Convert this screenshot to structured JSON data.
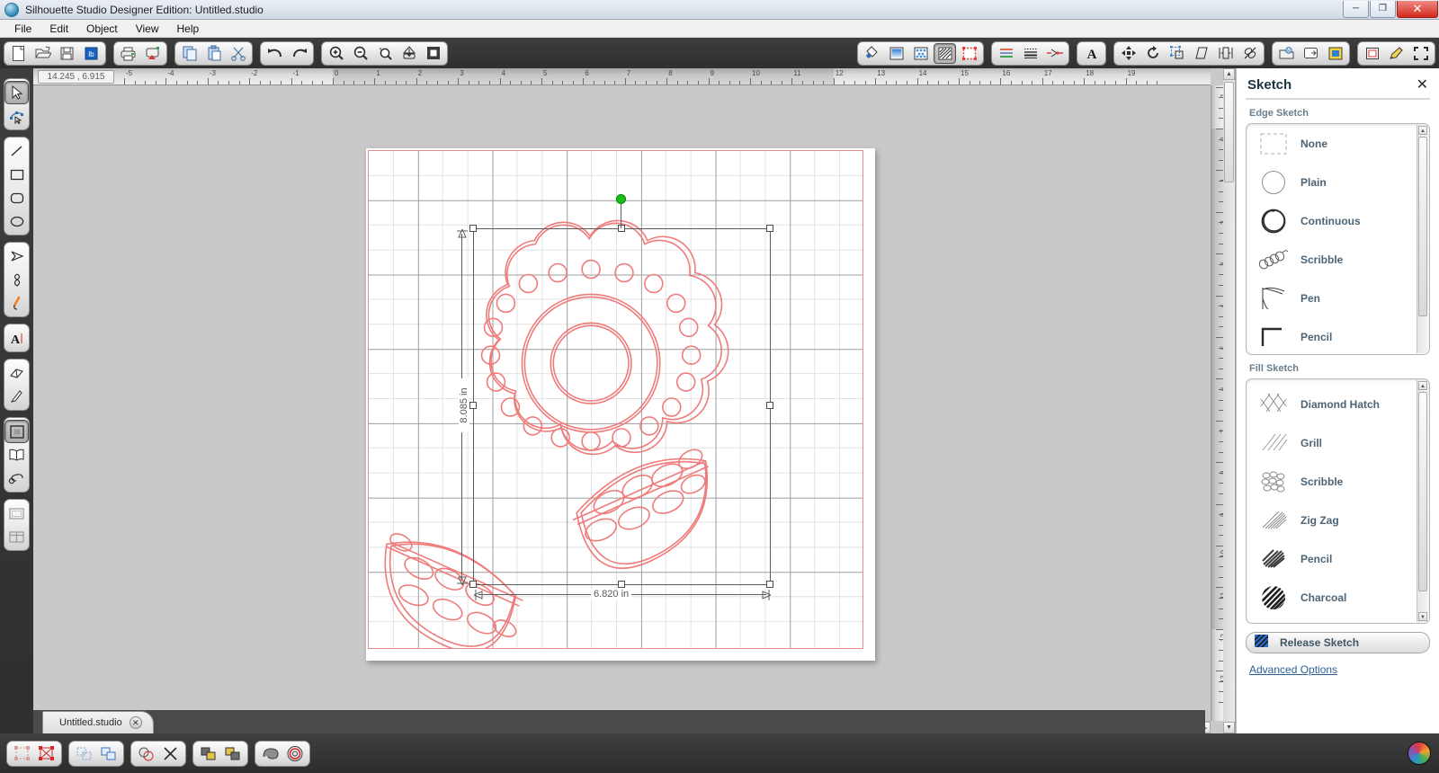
{
  "window": {
    "title": "Silhouette Studio Designer Edition: Untitled.studio",
    "minimize_label": "─",
    "maximize_label": "❐",
    "close_label": "✕"
  },
  "menubar": {
    "items": [
      "File",
      "Edit",
      "Object",
      "View",
      "Help"
    ]
  },
  "toolbar": {
    "groups": [
      {
        "name": "file",
        "buttons": [
          {
            "icon": "new-document-icon",
            "label": "New"
          },
          {
            "icon": "open-folder-icon",
            "label": "Open"
          },
          {
            "icon": "save-icon",
            "label": "Save"
          },
          {
            "icon": "save-library-icon",
            "label": "Save to Library"
          }
        ]
      },
      {
        "name": "output",
        "buttons": [
          {
            "icon": "print-icon",
            "label": "Print"
          },
          {
            "icon": "cut-send-icon",
            "label": "Send to Silhouette"
          }
        ]
      },
      {
        "name": "clipboard",
        "buttons": [
          {
            "icon": "copy-icon",
            "label": "Copy"
          },
          {
            "icon": "paste-icon",
            "label": "Paste"
          },
          {
            "icon": "scissors-icon",
            "label": "Cut"
          }
        ]
      },
      {
        "name": "history",
        "buttons": [
          {
            "icon": "undo-icon",
            "label": "Undo"
          },
          {
            "icon": "redo-icon",
            "label": "Redo"
          }
        ]
      },
      {
        "name": "zoom",
        "buttons": [
          {
            "icon": "zoom-in-icon",
            "label": "Zoom In"
          },
          {
            "icon": "zoom-out-icon",
            "label": "Zoom Out"
          },
          {
            "icon": "zoom-selection-icon",
            "label": "Zoom to Selection"
          },
          {
            "icon": "fit-to-window-icon",
            "label": "Fit to Window"
          },
          {
            "icon": "actual-size-icon",
            "label": "Actual Size"
          }
        ]
      }
    ],
    "right_groups": [
      {
        "name": "design-panels",
        "buttons": [
          {
            "icon": "paint-bucket-icon",
            "label": "Fill Color",
            "selected": false
          },
          {
            "icon": "gradient-fill-icon",
            "label": "Gradient Fill",
            "selected": false
          },
          {
            "icon": "pattern-fill-icon",
            "label": "Pattern Fill",
            "selected": false
          },
          {
            "icon": "sketch-icon",
            "label": "Sketch",
            "selected": true
          },
          {
            "icon": "line-color-icon",
            "label": "Line Color",
            "selected": false
          }
        ]
      },
      {
        "name": "line-style",
        "buttons": [
          {
            "icon": "line-color-swatches-icon",
            "label": "Line Color"
          },
          {
            "icon": "line-style-icon",
            "label": "Line Style"
          },
          {
            "icon": "cut-style-icon",
            "label": "Cut Style"
          }
        ]
      },
      {
        "name": "text",
        "buttons": [
          {
            "icon": "text-style-icon",
            "label": "Text Style"
          }
        ]
      },
      {
        "name": "transform",
        "buttons": [
          {
            "icon": "move-icon",
            "label": "Move"
          },
          {
            "icon": "rotate-icon",
            "label": "Rotate"
          },
          {
            "icon": "scale-icon",
            "label": "Scale"
          },
          {
            "icon": "shear-icon",
            "label": "Shear"
          },
          {
            "icon": "align-icon",
            "label": "Align"
          },
          {
            "icon": "modify-icon",
            "label": "Modify"
          }
        ]
      },
      {
        "name": "page",
        "buttons": [
          {
            "icon": "page-setup-icon",
            "label": "Page Setup"
          },
          {
            "icon": "registration-marks-icon",
            "label": "Registration Marks"
          },
          {
            "icon": "trace-icon",
            "label": "Trace"
          }
        ]
      },
      {
        "name": "view-modes",
        "buttons": [
          {
            "icon": "cut-preview-icon",
            "label": "Cut Preview"
          },
          {
            "icon": "pen-holder-icon",
            "label": "Sketch Preview"
          },
          {
            "icon": "fullscreen-icon",
            "label": "Full Screen"
          }
        ]
      }
    ]
  },
  "left_tools": {
    "groups": [
      {
        "name": "selection",
        "buttons": [
          {
            "icon": "arrow-select-icon",
            "label": "Select",
            "selected": true
          },
          {
            "icon": "edit-points-icon",
            "label": "Edit Points",
            "selected": false
          }
        ]
      },
      {
        "name": "shapes",
        "buttons": [
          {
            "icon": "line-tool-icon",
            "label": "Line"
          },
          {
            "icon": "rectangle-tool-icon",
            "label": "Rectangle"
          },
          {
            "icon": "rounded-rectangle-tool-icon",
            "label": "Rounded Rectangle"
          },
          {
            "icon": "ellipse-tool-icon",
            "label": "Ellipse"
          }
        ]
      },
      {
        "name": "draw",
        "buttons": [
          {
            "icon": "polygon-tool-icon",
            "label": "Polygon"
          },
          {
            "icon": "curve-tool-icon",
            "label": "Curve"
          },
          {
            "icon": "freehand-tool-icon",
            "label": "Freehand"
          }
        ]
      },
      {
        "name": "text-tool",
        "buttons": [
          {
            "icon": "text-tool-icon",
            "label": "Text"
          }
        ]
      },
      {
        "name": "edit-tools",
        "buttons": [
          {
            "icon": "eraser-tool-icon",
            "label": "Eraser"
          },
          {
            "icon": "knife-tool-icon",
            "label": "Knife"
          }
        ]
      },
      {
        "name": "library",
        "buttons": [
          {
            "icon": "my-library-icon",
            "label": "My Library",
            "selected": true
          },
          {
            "icon": "store-icon",
            "label": "Silhouette Store"
          },
          {
            "icon": "my-designs-icon",
            "label": "My Designs"
          }
        ]
      },
      {
        "name": "workspace",
        "buttons": [
          {
            "icon": "design-page-icon",
            "label": "Design Page"
          },
          {
            "icon": "split-view-icon",
            "label": "Split View"
          }
        ]
      }
    ]
  },
  "document": {
    "coordinates": "14.245 , 6.915",
    "h_ruler_labels": [
      "-5",
      "-4",
      "-3",
      "-2",
      "-1",
      "0",
      "1",
      "2",
      "3",
      "4",
      "5",
      "6",
      "7",
      "8",
      "9",
      "10",
      "11",
      "12",
      "13",
      "14",
      "15",
      "16",
      "17",
      "18",
      "19"
    ],
    "v_ruler_labels": [
      "-1",
      "0",
      "1",
      "2",
      "3",
      "4",
      "5",
      "6",
      "7",
      "8",
      "9",
      "10",
      "11",
      "12",
      "13"
    ],
    "units": "in",
    "selection": {
      "width_label": "6.820 in",
      "height_label": "8.085 in"
    },
    "design_color": "#ef7b7b",
    "mat_border_color": "#e98a8a"
  },
  "panel": {
    "title": "Sketch",
    "close_label": "✕",
    "edge_sketch": {
      "label": "Edge Sketch",
      "options": [
        {
          "icon": "none-dashed-square-icon",
          "label": "None"
        },
        {
          "icon": "plain-circle-icon",
          "label": "Plain"
        },
        {
          "icon": "continuous-circle-icon",
          "label": "Continuous"
        },
        {
          "icon": "scribble-coil-icon",
          "label": "Scribble"
        },
        {
          "icon": "pen-stroke-icon",
          "label": "Pen"
        },
        {
          "icon": "pencil-stroke-icon",
          "label": "Pencil"
        }
      ]
    },
    "fill_sketch": {
      "label": "Fill Sketch",
      "options": [
        {
          "icon": "diamond-hatch-icon",
          "label": "Diamond Hatch"
        },
        {
          "icon": "grill-icon",
          "label": "Grill"
        },
        {
          "icon": "scribble-fill-icon",
          "label": "Scribble"
        },
        {
          "icon": "zigzag-fill-icon",
          "label": "Zig Zag"
        },
        {
          "icon": "pencil-fill-icon",
          "label": "Pencil"
        },
        {
          "icon": "charcoal-fill-icon",
          "label": "Charcoal"
        }
      ]
    },
    "release_button": {
      "icon": "release-sketch-icon",
      "label": "Release Sketch"
    },
    "advanced_link": "Advanced Options"
  },
  "tabs": {
    "items": [
      {
        "name": "Untitled.studio",
        "close_label": "✕",
        "active": true
      }
    ]
  },
  "status_bar": {
    "groups": [
      {
        "name": "select-ops",
        "buttons": [
          {
            "icon": "select-all-icon",
            "label": "Select All"
          },
          {
            "icon": "deselect-all-icon",
            "label": "Deselect All"
          }
        ]
      },
      {
        "name": "group-ops",
        "buttons": [
          {
            "icon": "group-icon",
            "label": "Group"
          },
          {
            "icon": "ungroup-icon",
            "label": "Ungroup"
          }
        ]
      },
      {
        "name": "path-ops",
        "buttons": [
          {
            "icon": "weld-icon",
            "label": "Weld"
          },
          {
            "icon": "release-compound-icon",
            "label": "Release Compound Path"
          }
        ]
      },
      {
        "name": "order-ops",
        "buttons": [
          {
            "icon": "bring-to-front-icon",
            "label": "Bring to Front"
          },
          {
            "icon": "send-to-back-icon",
            "label": "Send to Back"
          }
        ]
      },
      {
        "name": "offset-ops",
        "buttons": [
          {
            "icon": "offset-icon",
            "label": "Offset"
          },
          {
            "icon": "internal-offset-icon",
            "label": "Internal Offset"
          }
        ]
      }
    ],
    "logo": "silhouette-logo-icon"
  }
}
